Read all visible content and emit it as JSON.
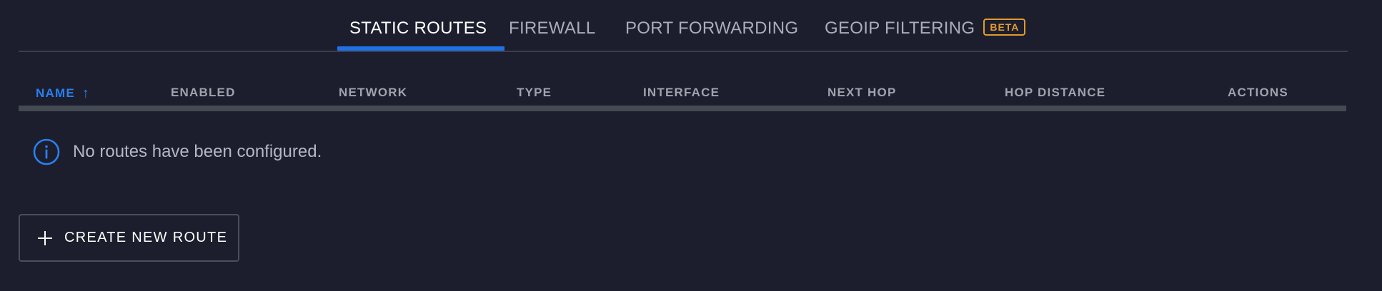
{
  "tabs": [
    {
      "label": "STATIC ROUTES",
      "active": true
    },
    {
      "label": "FIREWALL",
      "active": false
    },
    {
      "label": "PORT FORWARDING",
      "active": false
    },
    {
      "label": "GEOIP FILTERING",
      "active": false,
      "badge": "BETA"
    }
  ],
  "table": {
    "columns": [
      {
        "label": "NAME",
        "sorted": "ascending"
      },
      {
        "label": "ENABLED"
      },
      {
        "label": "NETWORK"
      },
      {
        "label": "TYPE"
      },
      {
        "label": "INTERFACE"
      },
      {
        "label": "NEXT HOP"
      },
      {
        "label": "HOP DISTANCE"
      },
      {
        "label": "ACTIONS"
      }
    ],
    "sort_icon": "arrow-up-icon"
  },
  "empty_state": {
    "icon": "info-icon",
    "message": "No routes have been configured."
  },
  "create_button": {
    "icon": "plus-icon",
    "label": "CREATE NEW ROUTE"
  },
  "colors": {
    "background": "#1c1e2d",
    "accent": "#1f72e6",
    "badge": "#e29b2e",
    "header_bar": "#444a52"
  }
}
